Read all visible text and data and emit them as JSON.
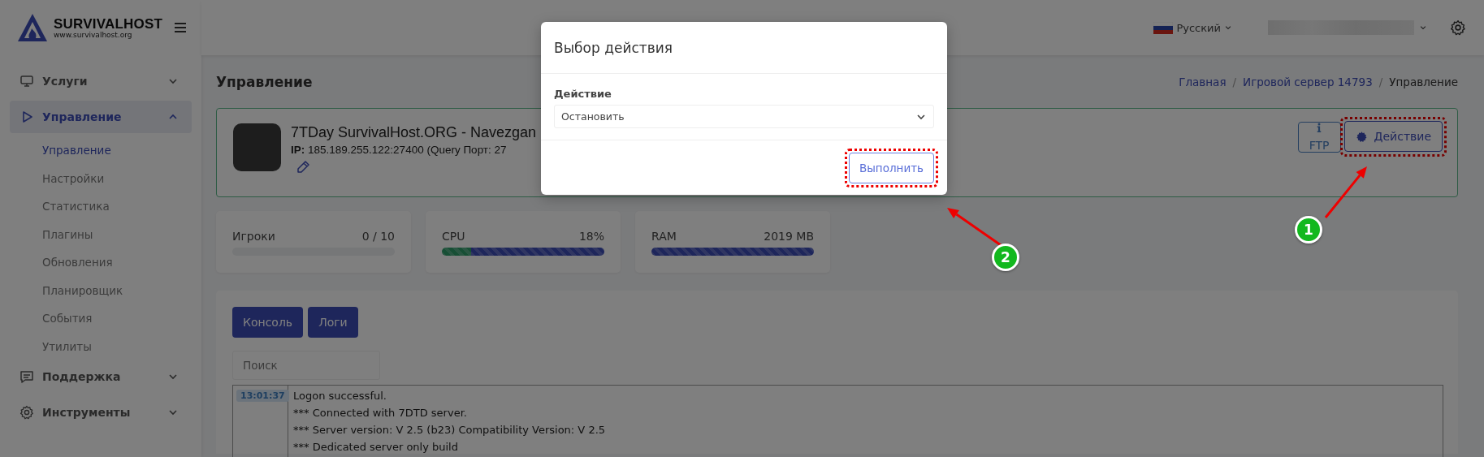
{
  "brand": {
    "name": "SURVIVALHOST",
    "url": "www.survivalhost.org"
  },
  "sidebar": {
    "items": [
      {
        "label": "Услуги",
        "selected": false,
        "expanded": false
      },
      {
        "label": "Управление",
        "selected": true,
        "expanded": true,
        "children": [
          {
            "label": "Управление",
            "selected": true
          },
          {
            "label": "Настройки",
            "selected": false
          },
          {
            "label": "Статистика",
            "selected": false
          },
          {
            "label": "Плагины",
            "selected": false
          },
          {
            "label": "Обновления",
            "selected": false
          },
          {
            "label": "Планировщик",
            "selected": false
          },
          {
            "label": "События",
            "selected": false
          },
          {
            "label": "Утилиты",
            "selected": false
          }
        ]
      },
      {
        "label": "Поддержка",
        "selected": false,
        "expanded": false
      },
      {
        "label": "Инструменты",
        "selected": false,
        "expanded": false
      }
    ]
  },
  "header": {
    "language": "Русский"
  },
  "page_title": "Управление",
  "breadcrumb": [
    {
      "label": "Главная",
      "selected": false
    },
    {
      "separator": "/",
      "label": "Игровой сервер 14793",
      "selected": false
    },
    {
      "separator": "/",
      "label": "Управление",
      "selected": true
    }
  ],
  "server": {
    "name": "7TDay SurvivalHost.ORG - Navezgan",
    "ip_label": "IP:",
    "ip": "185.189.255.122:27400 (Query Порт: 27",
    "buttons": [
      {
        "label": "FTP",
        "kind": "info",
        "highlighted": false
      },
      {
        "label": "Действие",
        "kind": "action",
        "highlighted": true
      }
    ]
  },
  "stats": [
    {
      "label": "Игроки",
      "reading": "0 / 10"
    },
    {
      "label": "CPU",
      "reading": "18%",
      "segments": [
        {
          "level": 0.18,
          "kind": "success"
        },
        {
          "level": 0.82,
          "kind": "primary"
        }
      ]
    },
    {
      "label": "RAM",
      "reading": "2019 MB",
      "segments": [
        {
          "level": 1,
          "kind": "primary"
        }
      ]
    }
  ],
  "console": {
    "buttons": [
      "Консоль",
      "Логи"
    ],
    "search": {
      "placeholder": "Поиск"
    },
    "log": [
      {
        "time": "13:01:37",
        "lines": [
          "Logon successful.",
          "*** Connected with 7DTD server.",
          "*** Server version: V 2.5 (b23) Compatibility Version: V 2.5",
          "*** Dedicated server only build"
        ]
      }
    ]
  },
  "modal": {
    "title": "Выбор действия",
    "field_label": "Действие",
    "value": "Остановить",
    "submit": {
      "label": "Выполнить",
      "highlighted": true
    }
  },
  "annotations": [
    {
      "number": "1"
    },
    {
      "number": "2"
    }
  ]
}
